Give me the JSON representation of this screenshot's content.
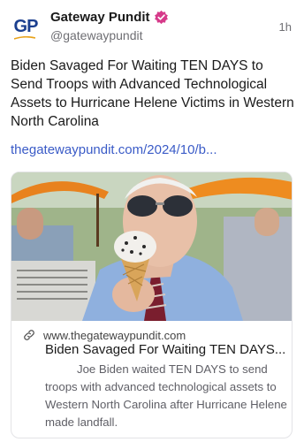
{
  "post": {
    "avatar_letters": "GP",
    "author_name": "Gateway Pundit",
    "handle": "@gatewaypundit",
    "timestamp": "1h",
    "verified_color": "#d63a8a",
    "text": "Biden Savaged For Waiting TEN DAYS to Send Troops with Advanced Technological Assets to Hurricane Helene Victims in Western North Carolina",
    "link_text": "thegatewaypundit.com/2024/10/b..."
  },
  "card": {
    "image_alt": "Man in aviator sunglasses eating an ice cream cone",
    "domain": "www.thegatewaypundit.com",
    "title": "Biden Savaged For Waiting TEN DAYS...",
    "description": "Joe Biden waited TEN DAYS to send troops with advanced technological assets to Western North Carolina after Hurricane Helene made landfall."
  },
  "icons": {
    "avatar": "gp-logo-icon",
    "verified": "verified-badge-icon",
    "link": "link-icon"
  },
  "colors": {
    "link": "#3a5bc7",
    "secondary_text": "#6e6e73",
    "brand_blue": "#1b3f8f"
  }
}
